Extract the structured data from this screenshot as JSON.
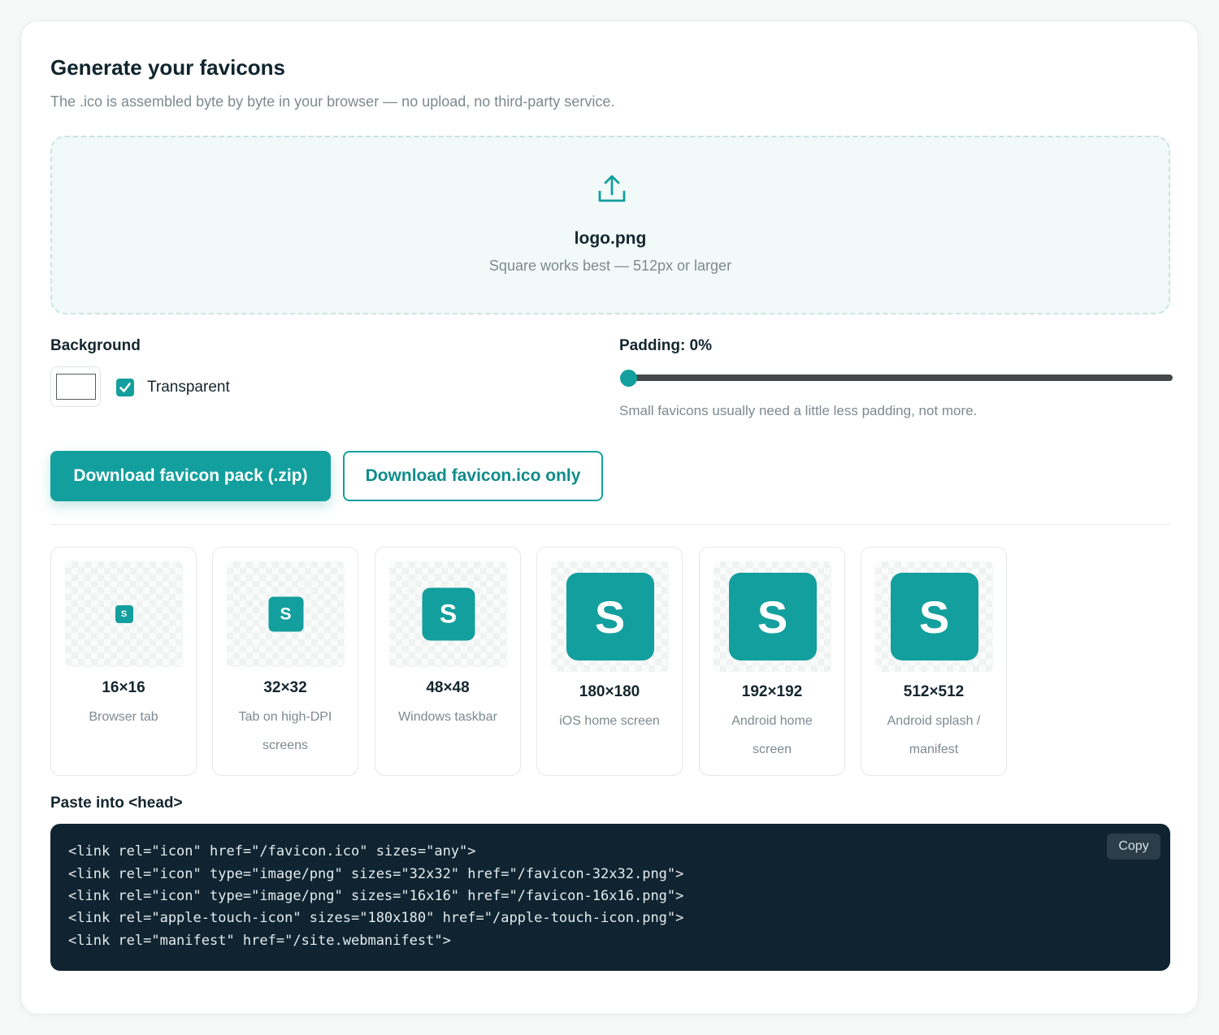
{
  "page": {
    "title": "Generate your favicons",
    "subtitle": "The .ico is assembled byte by byte in your browser — no upload, no third-party service."
  },
  "dropzone": {
    "icon": "upload-icon",
    "file_name": "logo.png",
    "hint": "Square works best — 512px or larger"
  },
  "background": {
    "label": "Background",
    "swatch_color": "#ffffff",
    "transparent_label": "Transparent",
    "transparent_checked": true
  },
  "padding": {
    "label": "Padding: 0%",
    "value_percent": 0,
    "hint": "Small favicons usually need a little less padding, not more."
  },
  "actions": {
    "primary_label": "Download favicon pack (.zip)",
    "secondary_label": "Download favicon.ico only"
  },
  "previews": [
    {
      "glyph": "S",
      "size": "16×16",
      "description": "Browser tab"
    },
    {
      "glyph": "S",
      "size": "32×32",
      "description": "Tab on high-DPI screens"
    },
    {
      "glyph": "S",
      "size": "48×48",
      "description": "Windows taskbar"
    },
    {
      "glyph": "S",
      "size": "180×180",
      "description": "iOS home screen"
    },
    {
      "glyph": "S",
      "size": "192×192",
      "description": "Android home screen"
    },
    {
      "glyph": "S",
      "size": "512×512",
      "description": "Android splash / manifest"
    }
  ],
  "code": {
    "label": "Paste into <head>",
    "copy_label": "Copy",
    "lines": [
      "<link rel=\"icon\" href=\"/favicon.ico\" sizes=\"any\">",
      "<link rel=\"icon\" type=\"image/png\" sizes=\"32x32\" href=\"/favicon-32x32.png\">",
      "<link rel=\"icon\" type=\"image/png\" sizes=\"16x16\" href=\"/favicon-16x16.png\">",
      "<link rel=\"apple-touch-icon\" sizes=\"180x180\" href=\"/apple-touch-icon.png\">",
      "<link rel=\"manifest\" href=\"/site.webmanifest\">"
    ]
  },
  "colors": {
    "accent": "#139f9d",
    "code_background": "#0f2430",
    "muted_text": "#7c8a90"
  }
}
